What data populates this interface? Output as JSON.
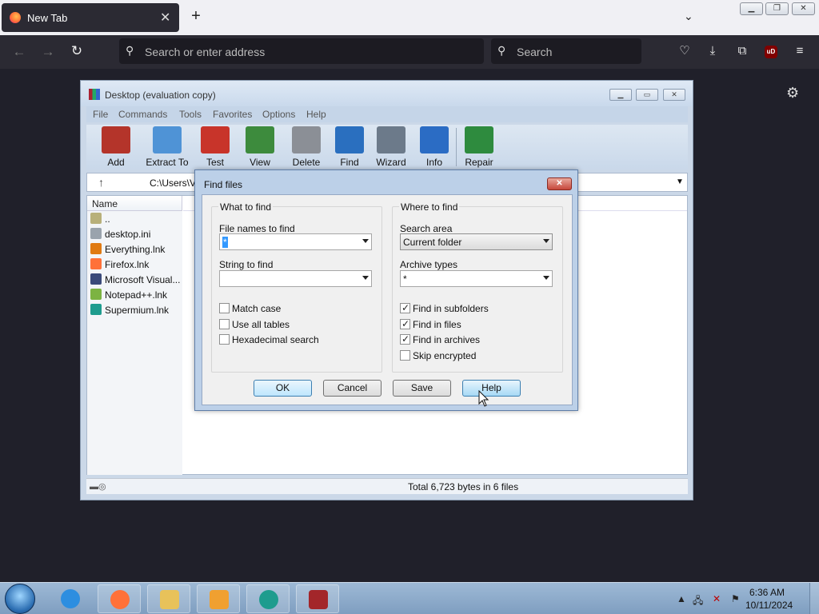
{
  "browser": {
    "tab_title": "New Tab",
    "url_placeholder": "Search or enter address",
    "search_placeholder": "Search",
    "ublock_label": "uD"
  },
  "winrar": {
    "title": "Desktop (evaluation copy)",
    "menu": [
      "File",
      "Commands",
      "Tools",
      "Favorites",
      "Options",
      "Help"
    ],
    "toolbar": [
      {
        "label": "Add",
        "icon": "books-icon",
        "color": "#b4342a"
      },
      {
        "label": "Extract To",
        "icon": "folder-extract-icon",
        "color": "#4f93d6"
      },
      {
        "label": "Test",
        "icon": "checklist-icon",
        "color": "#c8342a"
      },
      {
        "label": "View",
        "icon": "book-icon",
        "color": "#3d8b3d"
      },
      {
        "label": "Delete",
        "icon": "trash-icon",
        "color": "#8b8f96"
      },
      {
        "label": "Find",
        "icon": "magnifier-icon",
        "color": "#2a6fbf"
      },
      {
        "label": "Wizard",
        "icon": "wand-icon",
        "color": "#6c7a8a"
      },
      {
        "label": "Info",
        "icon": "info-icon",
        "color": "#2b6cc4"
      },
      {
        "label": "Repair",
        "icon": "repair-kit-icon",
        "color": "#2e8b3e"
      }
    ],
    "path": "C:\\Users\\V",
    "column_name": "Name",
    "files": [
      {
        "name": "..",
        "icon": "folder-up-icon",
        "color": "#b8b07a"
      },
      {
        "name": "desktop.ini",
        "icon": "settings-file-icon",
        "color": "#9aa3ad"
      },
      {
        "name": "Everything.lnk",
        "icon": "magnifier-icon",
        "color": "#e07a12"
      },
      {
        "name": "Firefox.lnk",
        "icon": "firefox-icon",
        "color": "#ff7139"
      },
      {
        "name": "Microsoft Visual...",
        "icon": "infinity-icon",
        "color": "#3b4a7a"
      },
      {
        "name": "Notepad++.lnk",
        "icon": "notepad-icon",
        "color": "#7cb342"
      },
      {
        "name": "Supermium.lnk",
        "icon": "globe-icon",
        "color": "#1e9c8e"
      }
    ],
    "status": "Total 6,723 bytes in 6 files"
  },
  "dialog": {
    "title": "Find files",
    "what_legend": "What to find",
    "file_names_label": "File names to find",
    "file_names_value": "*",
    "string_label": "String to find",
    "string_value": "",
    "checks_left": [
      {
        "label": "Match case",
        "checked": false
      },
      {
        "label": "Use all tables",
        "checked": false
      },
      {
        "label": "Hexadecimal search",
        "checked": false
      }
    ],
    "where_legend": "Where to find",
    "search_area_label": "Search area",
    "search_area_value": "Current folder",
    "archive_types_label": "Archive types",
    "archive_types_value": "*",
    "checks_right": [
      {
        "label": "Find in subfolders",
        "checked": true
      },
      {
        "label": "Find in files",
        "checked": true
      },
      {
        "label": "Find in archives",
        "checked": true
      },
      {
        "label": "Skip encrypted",
        "checked": false
      }
    ],
    "buttons": {
      "ok": "OK",
      "cancel": "Cancel",
      "save": "Save",
      "help": "Help"
    }
  },
  "taskbar": {
    "time": "6:36 AM",
    "date": "10/11/2024",
    "apps": [
      {
        "name": "internet-explorer-icon",
        "color": "#2d8ee0"
      },
      {
        "name": "firefox-icon",
        "color": "#ff7139"
      },
      {
        "name": "file-explorer-icon",
        "color": "#e8c25a"
      },
      {
        "name": "media-player-icon",
        "color": "#f0a030"
      },
      {
        "name": "supermium-icon",
        "color": "#1e9c8e"
      },
      {
        "name": "winrar-icon",
        "color": "#a3262a"
      }
    ]
  }
}
